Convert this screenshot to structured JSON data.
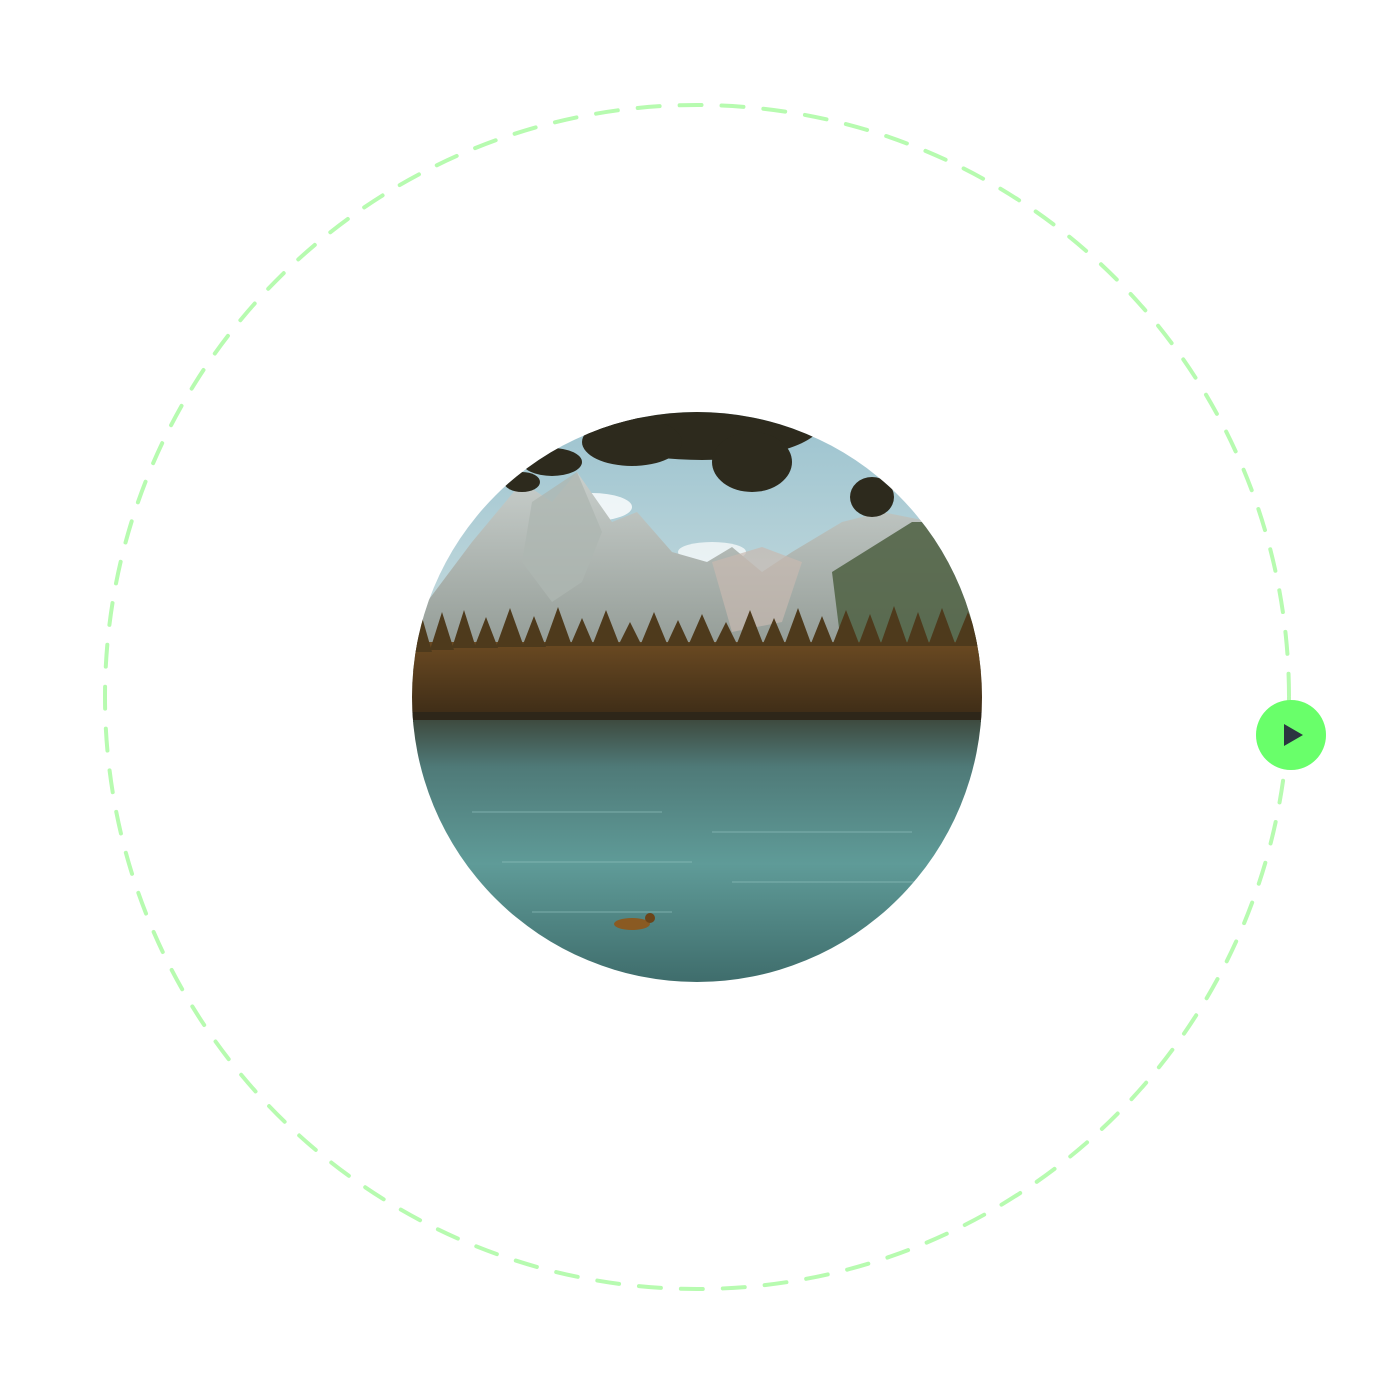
{
  "player": {
    "accent_color": "#69ff6a",
    "ring_color": "#b7fbb0",
    "icon_color": "#2b3540",
    "play_icon": "play-icon",
    "thumbnail": "mountain-lake-photo"
  }
}
